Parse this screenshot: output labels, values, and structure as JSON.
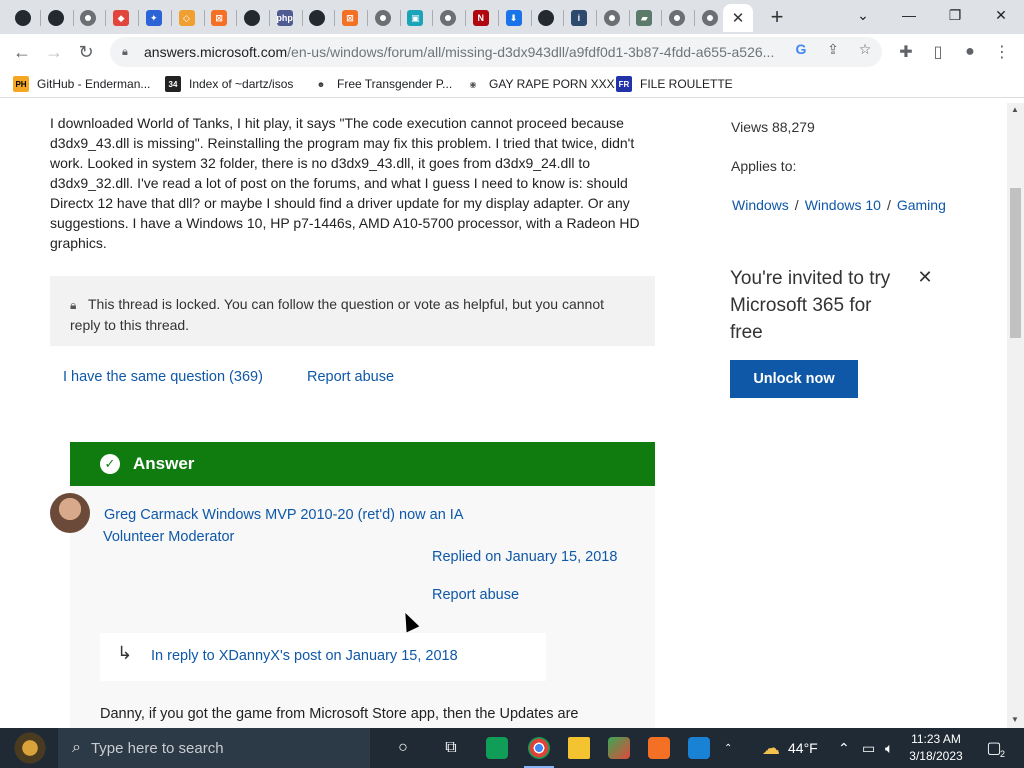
{
  "browser": {
    "tabs": [
      {
        "icon": "github-icon",
        "cls": "fav-gh",
        "glyph": ""
      },
      {
        "icon": "github-icon",
        "cls": "fav-gh",
        "glyph": ""
      },
      {
        "icon": "chrome-icon",
        "cls": "fav-chrome",
        "glyph": ""
      },
      {
        "icon": "red-diamond-icon",
        "color": "#e2453b",
        "glyph": "◆"
      },
      {
        "icon": "blue-bird-icon",
        "color": "#2c64d8",
        "glyph": "✦"
      },
      {
        "icon": "orange-diamond-icon",
        "color": "#f0a030",
        "glyph": "◇"
      },
      {
        "icon": "xampp-icon",
        "color": "#f37025",
        "glyph": "⊠"
      },
      {
        "icon": "github-icon",
        "cls": "fav-gh",
        "glyph": ""
      },
      {
        "icon": "php-icon",
        "color": "#4f5b93",
        "glyph": "php"
      },
      {
        "icon": "github-icon",
        "cls": "fav-gh",
        "glyph": ""
      },
      {
        "icon": "xampp-icon",
        "color": "#f37025",
        "glyph": "⊠"
      },
      {
        "icon": "chrome-icon",
        "cls": "fav-chrome",
        "glyph": ""
      },
      {
        "icon": "teal-app-icon",
        "color": "#1ba3b8",
        "glyph": "▣"
      },
      {
        "icon": "chrome-icon",
        "cls": "fav-chrome",
        "glyph": ""
      },
      {
        "icon": "netflix-icon",
        "color": "#b00610",
        "glyph": "N"
      },
      {
        "icon": "download-icon",
        "color": "#1a73e8",
        "glyph": "⬇"
      },
      {
        "icon": "github-icon",
        "cls": "fav-gh",
        "glyph": ""
      },
      {
        "icon": "guide-icon",
        "color": "#2d4a6e",
        "glyph": "i"
      },
      {
        "icon": "chrome-icon",
        "cls": "fav-chrome",
        "glyph": ""
      },
      {
        "icon": "tank-icon",
        "color": "#5c7a6a",
        "glyph": "▰"
      },
      {
        "icon": "chrome-icon",
        "cls": "fav-chrome",
        "glyph": ""
      },
      {
        "icon": "chrome-icon",
        "cls": "fav-chrome",
        "glyph": ""
      }
    ],
    "active_tab_close": "✕",
    "new_tab": "+",
    "url_host": "answers.microsoft.com",
    "url_path": "/en-us/windows/forum/all/missing-d3dx943dll/a9fdf0d1-3b87-4fdd-a655-a526...",
    "bookmarks": [
      {
        "label": "GitHub - Enderman...",
        "icon": "ph-icon",
        "badge": "PH",
        "bg": "#f5a623",
        "fg": "#000"
      },
      {
        "label": "Index of ~dartz/isos",
        "icon": "dartz-icon",
        "badge": "34",
        "bg": "#222",
        "fg": "#fff"
      },
      {
        "label": "Free Transgender P...",
        "icon": "mask-icon",
        "badge": "☻",
        "bg": "#fff",
        "fg": "#333"
      },
      {
        "label": "GAY RAPE PORN XXX",
        "icon": "globe-icon",
        "badge": "◉",
        "bg": "#fff",
        "fg": "#555"
      },
      {
        "label": "FILE ROULETTE",
        "icon": "file-roulette-icon",
        "badge": "FR",
        "bg": "#2233aa",
        "fg": "#fff"
      }
    ]
  },
  "page": {
    "question_text": "I downloaded World of Tanks, I hit play, it says \"The code execution cannot proceed because d3dx9_43.dll is missing\". Reinstalling the program may fix this problem. I tried that twice, didn't work. Looked in system 32 folder, there is no d3dx9_43.dll, it goes from d3dx9_24.dll to d3dx9_32.dll. I've read a lot of post on the forums, and what I guess I need to know is: should Directx 12 have that dll? or maybe I should find a driver update for my display adapter. Or any suggestions. I have a Windows 10, HP p7-1446s, AMD A10-5700 processor, with a Radeon HD graphics.",
    "locked_text": "This thread is locked. You can follow the question or vote as helpful, but you cannot reply to this thread.",
    "same_question": "I have the same question (369)",
    "report_abuse": "Report abuse",
    "answer_label": "Answer",
    "author": "Greg Carmack Windows MVP 2010-20 (ret'd) now an IA",
    "author_role": "Volunteer Moderator",
    "replied_on": "Replied on January 15, 2018",
    "answer_report": "Report abuse",
    "in_reply": "In reply to XDannyX's post on January 15, 2018",
    "answer_start": "Danny, if you got the game from Microsoft Store app, then the Updates are",
    "views": "Views 88,279",
    "applies_to": "Applies to:",
    "crumbs": [
      "Windows",
      "Windows 10",
      "Gaming"
    ],
    "crumb_sep": "/",
    "promo_text": "You're invited to try Microsoft 365 for free",
    "unlock": "Unlock now"
  },
  "taskbar": {
    "search_placeholder": "Type here to search",
    "weather": "44°F",
    "time": "11:23 AM",
    "date": "3/18/2023",
    "notifications": "2"
  }
}
